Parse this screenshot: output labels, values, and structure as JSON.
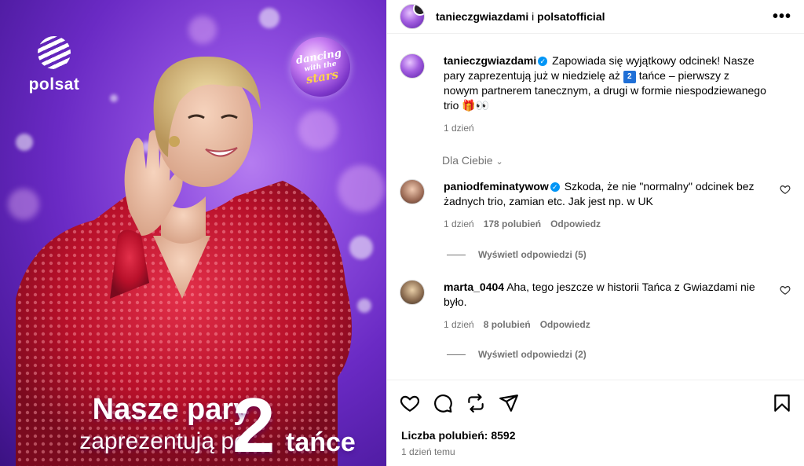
{
  "image": {
    "brand": "polsat",
    "show_logo": {
      "line1": "dancing",
      "line2": "with the",
      "line3": "stars"
    },
    "headline_line1": "Nasze pary",
    "headline_line2": "zaprezentują po",
    "headline_number": "2",
    "headline_end": "tańce"
  },
  "header": {
    "account1": "tanieczgwiazdami",
    "separator": " i ",
    "account2": "polsatofficial",
    "more": "•••"
  },
  "caption": {
    "user": "tanieczgwiazdami",
    "text_before": "Zapowiada się wyjątkowy odcinek! Nasze pary zaprezentują już w niedzielę aż",
    "number": "2",
    "text_after": "tańce – pierwszy z nowym partnerem tanecznym, a drugi w formie niespodziewanego trio 🎁👀",
    "time": "1 dzień"
  },
  "sort_label": "Dla Ciebie",
  "comments": [
    {
      "user": "paniodfeminatywow",
      "text": "Szkoda, że nie \"normalny\" odcinek bez żadnych trio, zamian etc. Jak jest np. w UK",
      "time": "1 dzień",
      "likes": "178 polubień",
      "reply": "Odpowiedz",
      "view_replies": "Wyświetl odpowiedzi (5)"
    },
    {
      "user": "marta_0404",
      "text": "Aha, tego jeszcze w historii Tańca z Gwiazdami nie było.",
      "time": "1 dzień",
      "likes": "8 polubień",
      "reply": "Odpowiedz",
      "view_replies": "Wyświetl odpowiedzi (2)"
    }
  ],
  "footer": {
    "likes_label": "Liczba polubień: 8592",
    "time": "1 dzień temu"
  }
}
